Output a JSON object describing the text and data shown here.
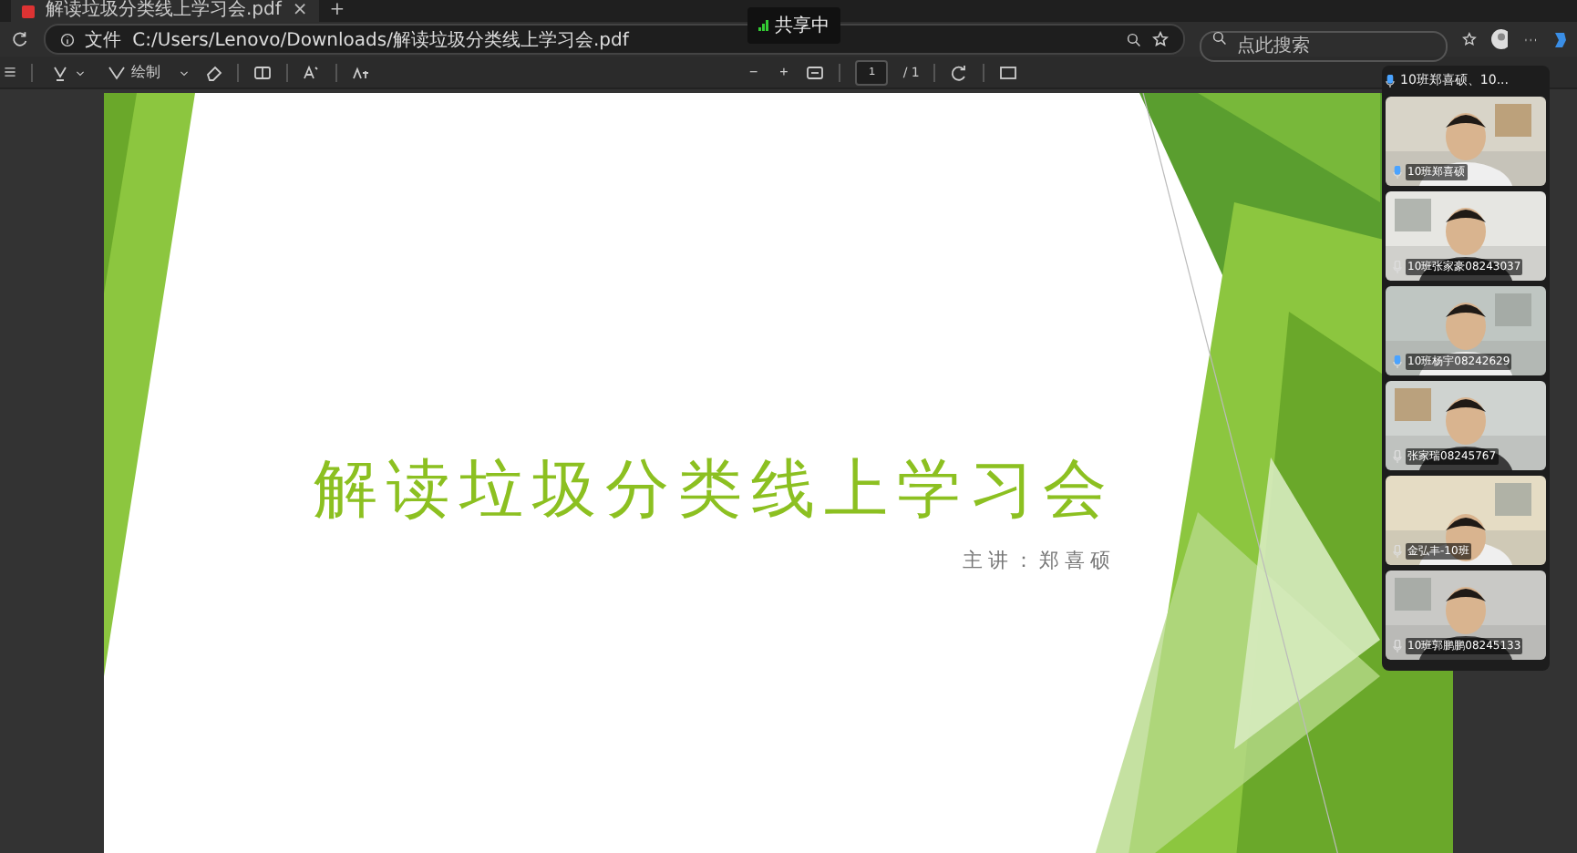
{
  "tab": {
    "title": "解读垃圾分类线上学习会.pdf",
    "close": "×",
    "new_tab": "+"
  },
  "address_bar": {
    "scheme": "文件",
    "url": "C:/Users/Lenovo/Downloads/解读垃圾分类线上学习会.pdf"
  },
  "search": {
    "placeholder": "点此搜索"
  },
  "sharing_badge": {
    "label": "共享中"
  },
  "toolbar": {
    "draw_label": "绘制",
    "zoom_out": "−",
    "zoom_in": "+",
    "page": "1",
    "page_total": "/ 1"
  },
  "slide": {
    "title": "解读垃圾分类线上学习会",
    "presenter": "主讲：郑喜硕"
  },
  "call_panel": {
    "title": "10班郑喜硕、10...",
    "participants": [
      {
        "name": "10班郑喜硕",
        "speaking": true
      },
      {
        "name": "10班张家豪08243037",
        "speaking": false
      },
      {
        "name": "10班杨宇08242629",
        "speaking": true
      },
      {
        "name": "张家瑞08245767",
        "speaking": false
      },
      {
        "name": "金弘丰-10班",
        "speaking": false
      },
      {
        "name": "10班郭鹏鹏08245133",
        "speaking": false
      }
    ]
  }
}
